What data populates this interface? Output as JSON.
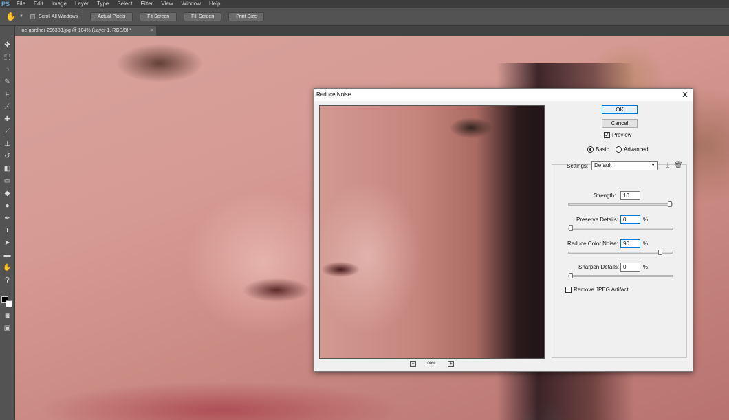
{
  "app": {
    "logo": "PS",
    "menu": [
      "File",
      "Edit",
      "Image",
      "Layer",
      "Type",
      "Select",
      "Filter",
      "View",
      "Window",
      "Help"
    ]
  },
  "options_bar": {
    "scroll_all_windows": "Scroll All Windows",
    "buttons": [
      "Actual Pixels",
      "Fit Screen",
      "Fill Screen",
      "Print Size"
    ]
  },
  "document": {
    "tab_title": "joe-gardner-296383.jpg @ 104% (Layer 1, RGB/8) *",
    "close": "×"
  },
  "dialog": {
    "title": "Reduce Noise",
    "close": "✕",
    "ok_label": "OK",
    "cancel_label": "Cancel",
    "preview_label": "Preview",
    "preview_checked": true,
    "mode_basic": "Basic",
    "mode_advanced": "Advanced",
    "selected_mode": "Basic",
    "settings_label": "Settings:",
    "settings_value": "Default",
    "zoom": {
      "minus": "−",
      "value": "100%",
      "plus": "+"
    },
    "controls": {
      "strength": {
        "label": "Strength:",
        "value": "10",
        "fraction": 1.0
      },
      "preserve_details": {
        "label": "Preserve Details:",
        "value": "0",
        "unit": "%",
        "fraction": 0.0
      },
      "reduce_color_noise": {
        "label": "Reduce Color Noise:",
        "value": "90",
        "unit": "%",
        "fraction": 0.9
      },
      "sharpen_details": {
        "label": "Sharpen Details:",
        "value": "0",
        "unit": "%",
        "fraction": 0.0
      }
    },
    "remove_jpeg_label": "Remove JPEG Artifact",
    "remove_jpeg_checked": false
  }
}
